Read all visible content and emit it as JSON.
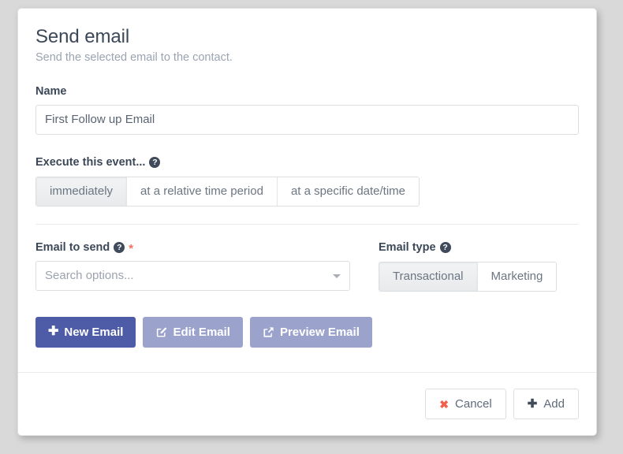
{
  "dialog": {
    "title": "Send email",
    "subtitle": "Send the selected email to the contact.",
    "help_glyph": "?",
    "required_glyph": "*"
  },
  "name_field": {
    "label": "Name",
    "value": "First Follow up Email",
    "placeholder": ""
  },
  "execute_event": {
    "label": "Execute this event...",
    "options": [
      {
        "label": "immediately",
        "active": true
      },
      {
        "label": "at a relative time period",
        "active": false
      },
      {
        "label": "at a specific date/time",
        "active": false
      }
    ]
  },
  "email_to_send": {
    "label": "Email to send",
    "placeholder": "Search options...",
    "caret_icon": "chevron-down-icon"
  },
  "email_type": {
    "label": "Email type",
    "options": [
      {
        "label": "Transactional",
        "active": true
      },
      {
        "label": "Marketing",
        "active": false
      }
    ]
  },
  "actions": {
    "new_email": {
      "label": "New Email",
      "icon": "plus-icon"
    },
    "edit_email": {
      "label": "Edit Email",
      "icon": "pencil-square-icon"
    },
    "preview_email": {
      "label": "Preview Email",
      "icon": "external-link-icon"
    }
  },
  "footer": {
    "cancel": {
      "label": "Cancel",
      "icon": "close-icon",
      "glyph": "✖"
    },
    "add": {
      "label": "Add",
      "icon": "plus-icon",
      "glyph": "✚"
    }
  },
  "colors": {
    "primary": "#4e5ba6",
    "primary_muted": "#9ba3cd",
    "danger": "#f2604c",
    "required": "#f76f5e",
    "title": "#3c4858",
    "subtitle": "#9aa4b1",
    "page_background": "#d9d9d9"
  }
}
